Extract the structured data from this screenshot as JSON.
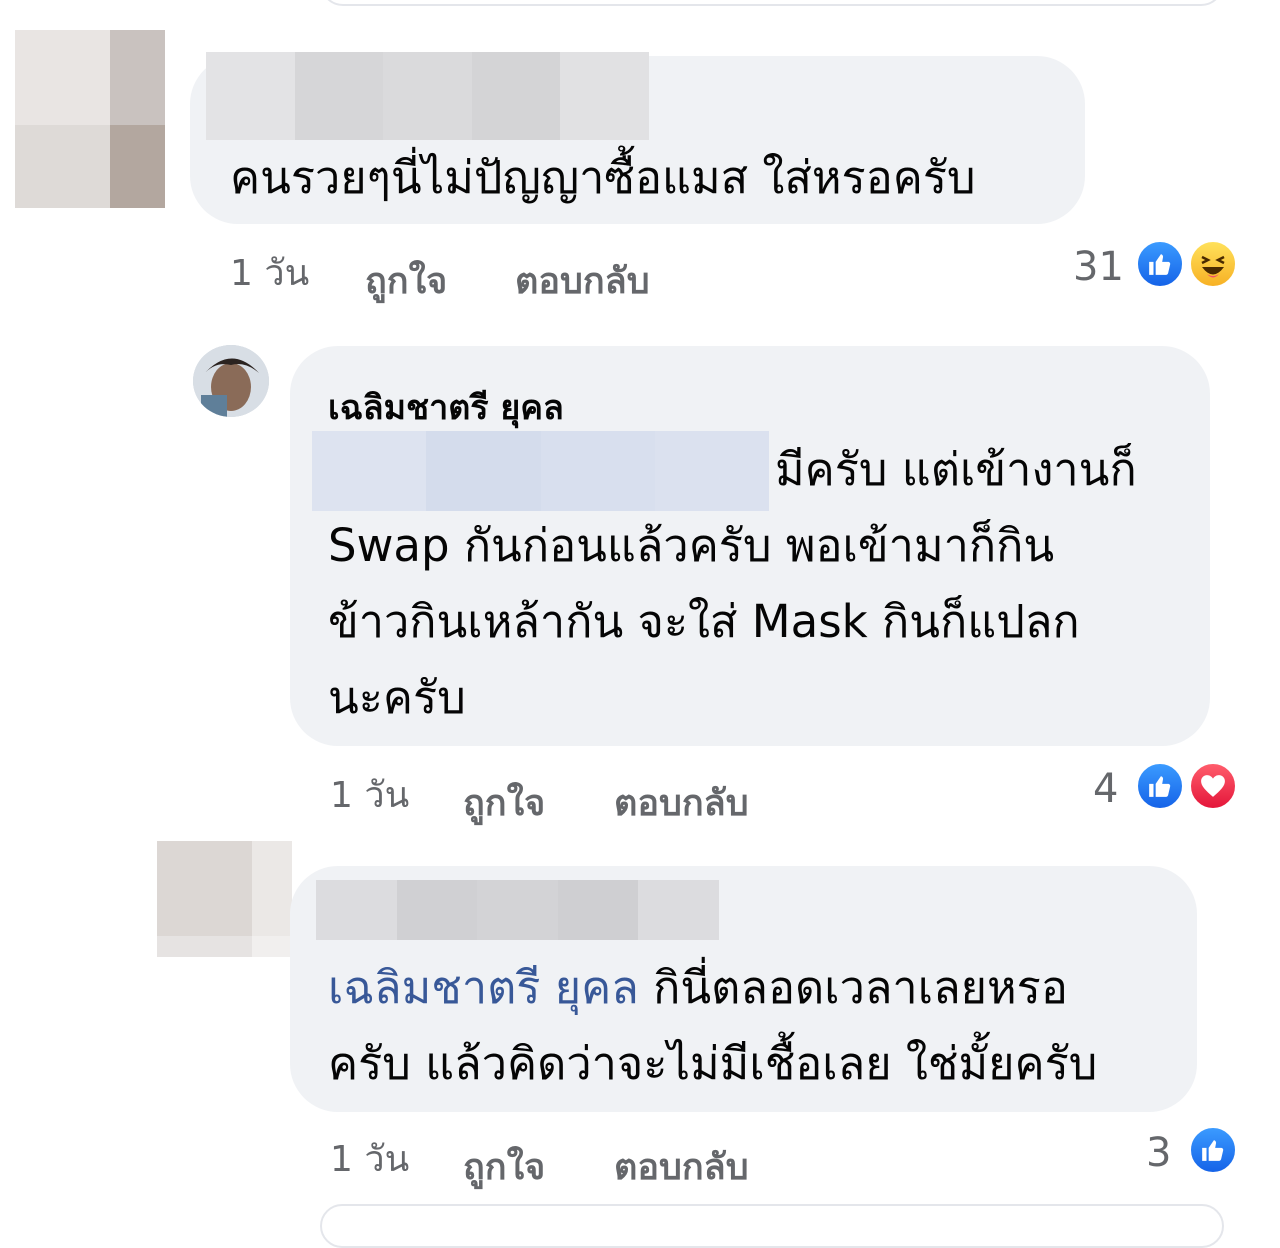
{
  "comments": [
    {
      "text": "คนรวยๆนี่ไม่ปัญญาซื้อแมส ใส่หรอครับ",
      "time": "1 วัน",
      "like_label": "ถูกใจ",
      "reply_label": "ตอบกลับ",
      "reaction_count": "31",
      "reactions": [
        "like-icon",
        "haha-icon"
      ]
    },
    {
      "author": "เฉลิมชาตรี ยุคล",
      "text_lines": [
        "มีครับ แต่เข้างานก็",
        "Swap กันก่อนแล้วครับ พอเข้ามาก็กิน",
        "ข้าวกินเหล้ากัน จะใส่ Mask กินก็แปลก",
        "นะครับ"
      ],
      "time": "1 วัน",
      "like_label": "ถูกใจ",
      "reply_label": "ตอบกลับ",
      "reaction_count": "4",
      "reactions": [
        "like-icon",
        "love-icon"
      ]
    },
    {
      "mention": "เฉลิมชาตรี ยุคล",
      "text_lines": [
        "กินี่ตลอดเวลาเลยหรอ",
        "ครับ แล้วคิดว่าจะไม่มีเชื้อเลย ใช่มั้ยครับ"
      ],
      "time": "1 วัน",
      "like_label": "ถูกใจ",
      "reply_label": "ตอบกลับ",
      "reaction_count": "3",
      "reactions": [
        "like-icon"
      ]
    }
  ],
  "colors": {
    "bubble": "#f0f2f5",
    "meta_text": "#65676b",
    "mention": "#385898",
    "like": "#1877f2",
    "love": "#f33e58",
    "haha": "#f7b125"
  }
}
